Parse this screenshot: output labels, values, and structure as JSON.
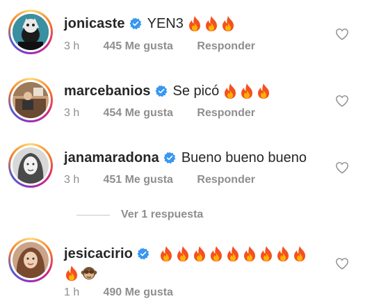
{
  "comments": [
    {
      "username": "jonicaste",
      "text": "YEN3",
      "fire_count": 3,
      "time": "3 h",
      "likes": "445 Me gusta",
      "reply": "Responder"
    },
    {
      "username": "marcebanios",
      "text": "Se picó",
      "fire_count": 3,
      "time": "3 h",
      "likes": "454 Me gusta",
      "reply": "Responder"
    },
    {
      "username": "janamaradona",
      "text": "Bueno bueno bueno",
      "fire_count": 0,
      "time": "3 h",
      "likes": "451 Me gusta",
      "reply": "Responder",
      "view_replies": "Ver 1 respuesta"
    },
    {
      "username": "jesicacirio",
      "text": "",
      "fire_count": 10,
      "extra_emoji": "see-no-evil-monkey",
      "time": "1 h",
      "likes": "490 Me gusta",
      "reply": ""
    }
  ],
  "colors": {
    "primary_text": "#262626",
    "secondary_text": "#8e8e8e",
    "verified_blue": "#3897f0",
    "heart_outline": "#8e8e8e"
  },
  "icons": [
    "verified-badge-icon",
    "fire-emoji-icon",
    "heart-outline-icon",
    "see-no-evil-monkey-icon"
  ]
}
